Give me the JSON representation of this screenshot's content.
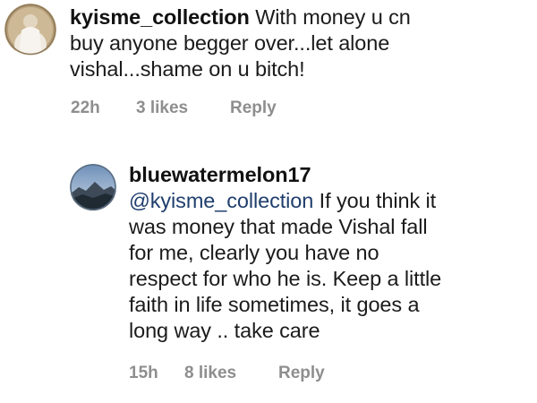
{
  "comments": [
    {
      "username": "kyisme_collection",
      "lines": [
        "With money u cn",
        "buy anyone begger over...let alone",
        "vishal...shame on u bitch!"
      ],
      "time": "22h",
      "likes": "3 likes",
      "reply_label": "Reply",
      "avatar_icon": "profile-photo-person-white-dress"
    },
    {
      "username": "bluewatermelon17",
      "mention": "@kyisme_collection",
      "lines": [
        "If you think it",
        "was money that made Vishal fall",
        "for me, clearly you have no",
        "respect for who he is. Keep a little",
        "faith in life sometimes, it goes a",
        "long way .. take care"
      ],
      "time": "15h",
      "likes": "8 likes",
      "reply_label": "Reply",
      "avatar_icon": "profile-photo-mountain-landscape"
    }
  ],
  "colors": {
    "text": "#1b1b1b",
    "username": "#111111",
    "mention": "#1f3e6d",
    "meta": "#8e8e8e",
    "background": "#ffffff"
  }
}
